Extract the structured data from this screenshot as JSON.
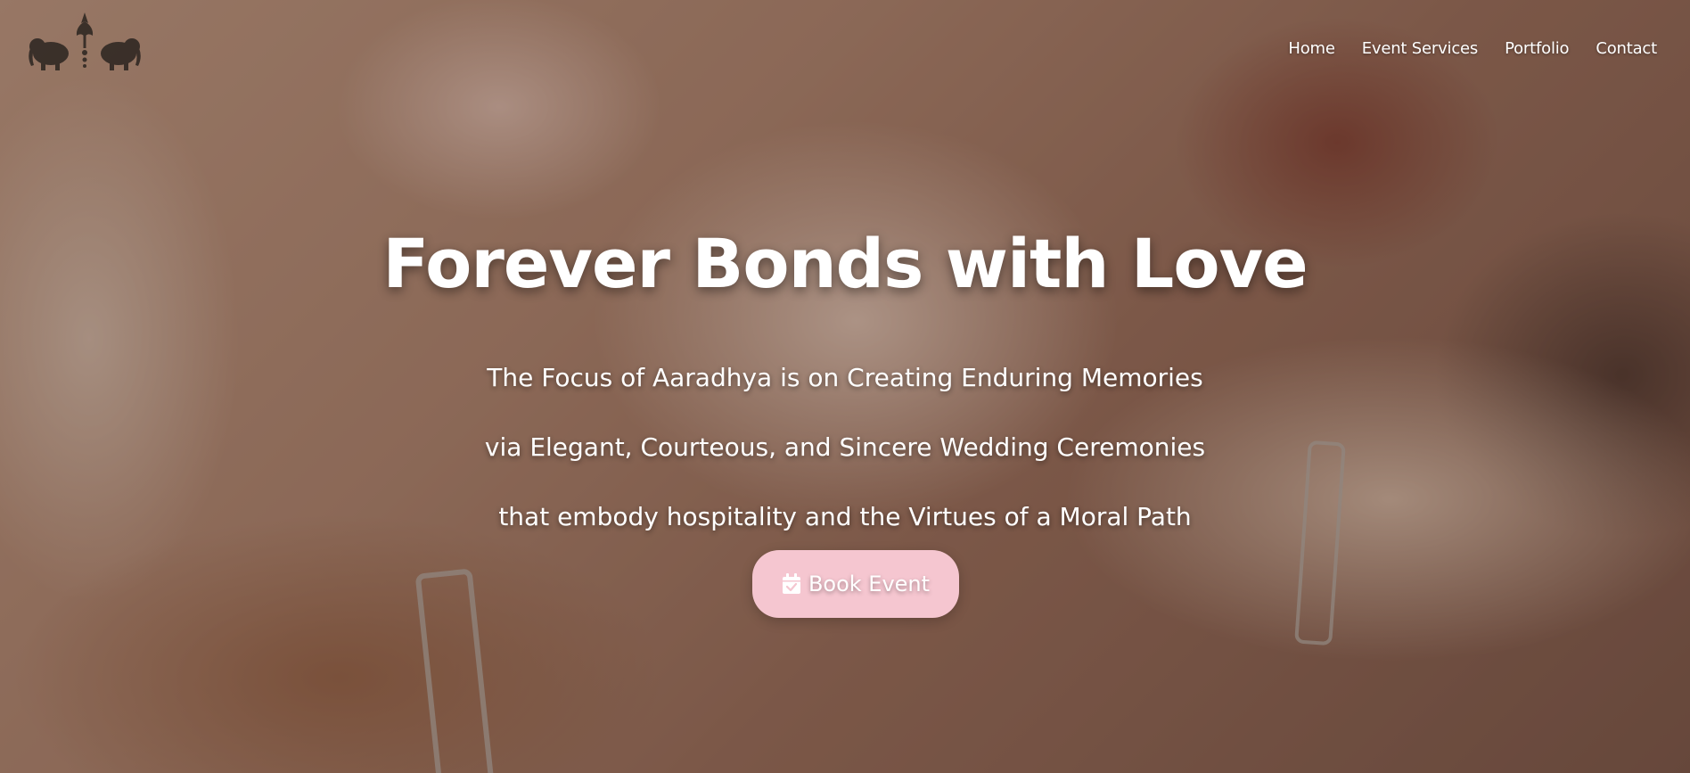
{
  "nav": {
    "items": [
      {
        "label": "Home"
      },
      {
        "label": "Event Services"
      },
      {
        "label": "Portfolio"
      },
      {
        "label": "Contact"
      }
    ]
  },
  "hero": {
    "title": "Forever Bonds with Love",
    "lines": [
      "The Focus of Aaradhya is on Creating Enduring Memories",
      "via Elegant, Courteous, and Sincere Wedding Ceremonies",
      "that embody hospitality and the Virtues of a Moral Path"
    ],
    "button": {
      "label": "Book Event",
      "icon": "calendar-check-icon"
    }
  },
  "logo": {
    "icon": "elephant-logo-icon"
  },
  "colors": {
    "button_bg": "#f5c6d0",
    "text": "#ffffff"
  }
}
